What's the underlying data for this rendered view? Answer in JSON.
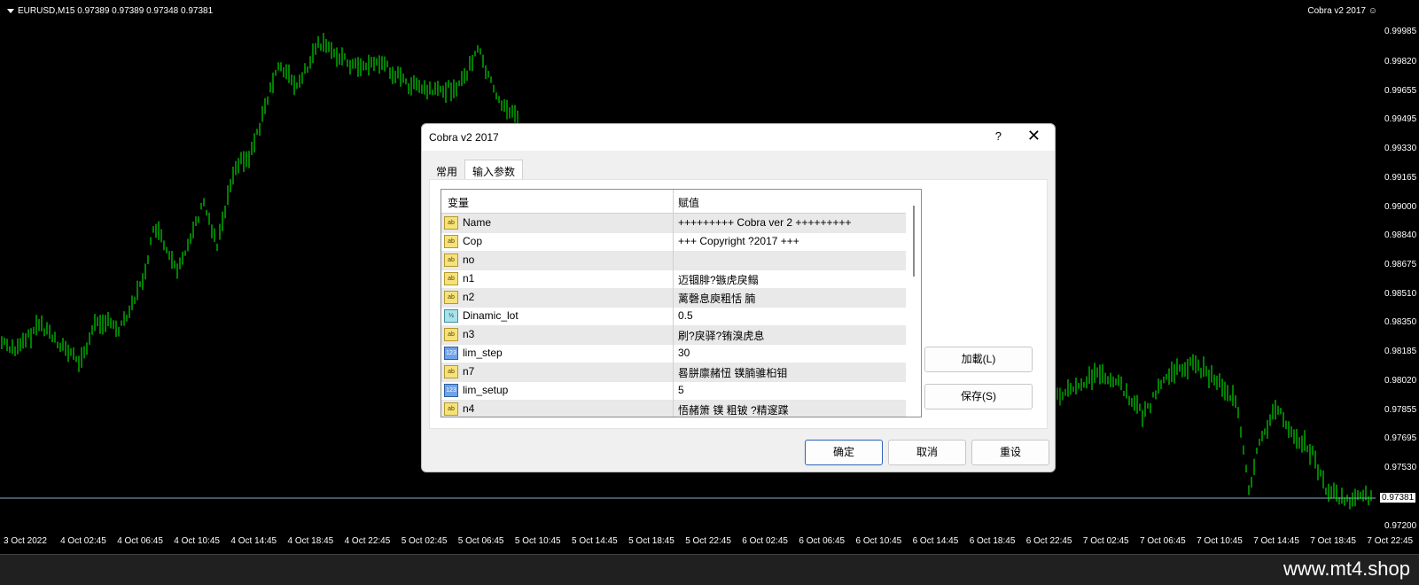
{
  "chart": {
    "symbol_info": "EURUSD,M15  0.97389 0.97389 0.97348 0.97381",
    "ea_name": "Cobra v2 2017",
    "current_price": "0.97381",
    "price_ticks": [
      "0.99985",
      "0.99820",
      "0.99655",
      "0.99495",
      "0.99330",
      "0.99165",
      "0.99000",
      "0.98840",
      "0.98675",
      "0.98510",
      "0.98350",
      "0.98185",
      "0.98020",
      "0.97855",
      "0.97695",
      "0.97530",
      "0.97200"
    ],
    "time_ticks": [
      "3 Oct 2022",
      "4 Oct 02:45",
      "4 Oct 06:45",
      "4 Oct 10:45",
      "4 Oct 14:45",
      "4 Oct 18:45",
      "4 Oct 22:45",
      "5 Oct 02:45",
      "5 Oct 06:45",
      "5 Oct 10:45",
      "5 Oct 14:45",
      "5 Oct 18:45",
      "5 Oct 22:45",
      "6 Oct 02:45",
      "6 Oct 06:45",
      "6 Oct 10:45",
      "6 Oct 14:45",
      "6 Oct 18:45",
      "6 Oct 22:45",
      "7 Oct 02:45",
      "7 Oct 06:45",
      "7 Oct 10:45",
      "7 Oct 14:45",
      "7 Oct 18:45",
      "7 Oct 22:45"
    ],
    "line_color": "#00ff00",
    "price_line_color": "#7fb0c8"
  },
  "dialog": {
    "title": "Cobra v2 2017",
    "help": "?",
    "close": "✕",
    "tabs": [
      "常用",
      "输入参数"
    ],
    "grid": {
      "col_variable": "变量",
      "col_value": "赋值",
      "rows": [
        {
          "icon": "ab",
          "name": "Name",
          "value": "+++++++++ Cobra ver 2 +++++++++"
        },
        {
          "icon": "ab",
          "name": "Cop",
          "value": "+++ Copyright ?2017 +++"
        },
        {
          "icon": "ab",
          "name": "no",
          "value": ""
        },
        {
          "icon": "ab",
          "name": "n1",
          "value": "迈锢腓?镞虎戾鳎"
        },
        {
          "icon": "ab",
          "name": "n2",
          "value": "蓠磬息庾粗恬 腩"
        },
        {
          "icon": "½",
          "name": "Dinamic_lot",
          "value": "0.5"
        },
        {
          "icon": "ab",
          "name": "n3",
          "value": "刷?戾驿?铕溴虎息"
        },
        {
          "icon": "123",
          "name": "lim_step",
          "value": "30"
        },
        {
          "icon": "ab",
          "name": "n7",
          "value": "晷胼廪赭忸 镤腩骓桕钼"
        },
        {
          "icon": "123",
          "name": "lim_setup",
          "value": "5"
        },
        {
          "icon": "ab",
          "name": "n4",
          "value": "悟赭箫 镤 粗铍          ?精邃蹀"
        }
      ]
    },
    "load_button": "加載(L)",
    "save_button": "保存(S)",
    "ok_button": "确定",
    "cancel_button": "取消",
    "reset_button": "重设"
  },
  "watermark": "www.mt4.shop"
}
